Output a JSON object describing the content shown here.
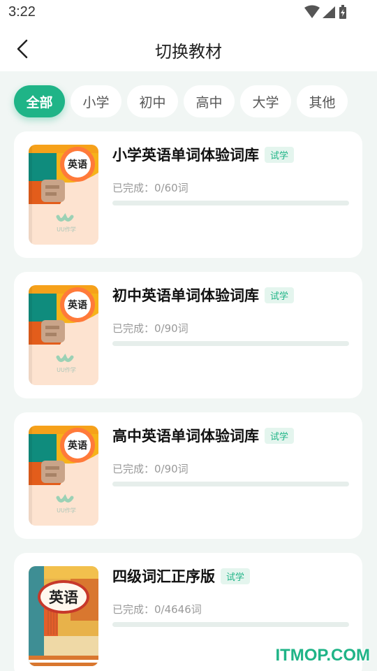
{
  "status": {
    "time": "3:22"
  },
  "header": {
    "title": "切换教材"
  },
  "tabs": [
    {
      "label": "全部",
      "active": true
    },
    {
      "label": "小学",
      "active": false
    },
    {
      "label": "初中",
      "active": false
    },
    {
      "label": "高中",
      "active": false
    },
    {
      "label": "大学",
      "active": false
    },
    {
      "label": "其他",
      "active": false
    }
  ],
  "books": [
    {
      "title": "小学英语单词体验词库",
      "badge": "试学",
      "progress_text": "已完成：0/60词",
      "progress": 0,
      "cover_text": "英语",
      "cover_brand": "UU作学"
    },
    {
      "title": "初中英语单词体验词库",
      "badge": "试学",
      "progress_text": "已完成：0/90词",
      "progress": 0,
      "cover_text": "英语",
      "cover_brand": "UU作学"
    },
    {
      "title": "高中英语单词体验词库",
      "badge": "试学",
      "progress_text": "已完成：0/90词",
      "progress": 0,
      "cover_text": "英语",
      "cover_brand": "UU作学"
    },
    {
      "title": "四级词汇正序版",
      "badge": "试学",
      "progress_text": "已完成：0/4646词",
      "progress": 0,
      "cover_text": "英语"
    }
  ],
  "watermark": "ITMOP.COM",
  "colors": {
    "accent": "#1fb487",
    "background": "#f1f6f4"
  }
}
